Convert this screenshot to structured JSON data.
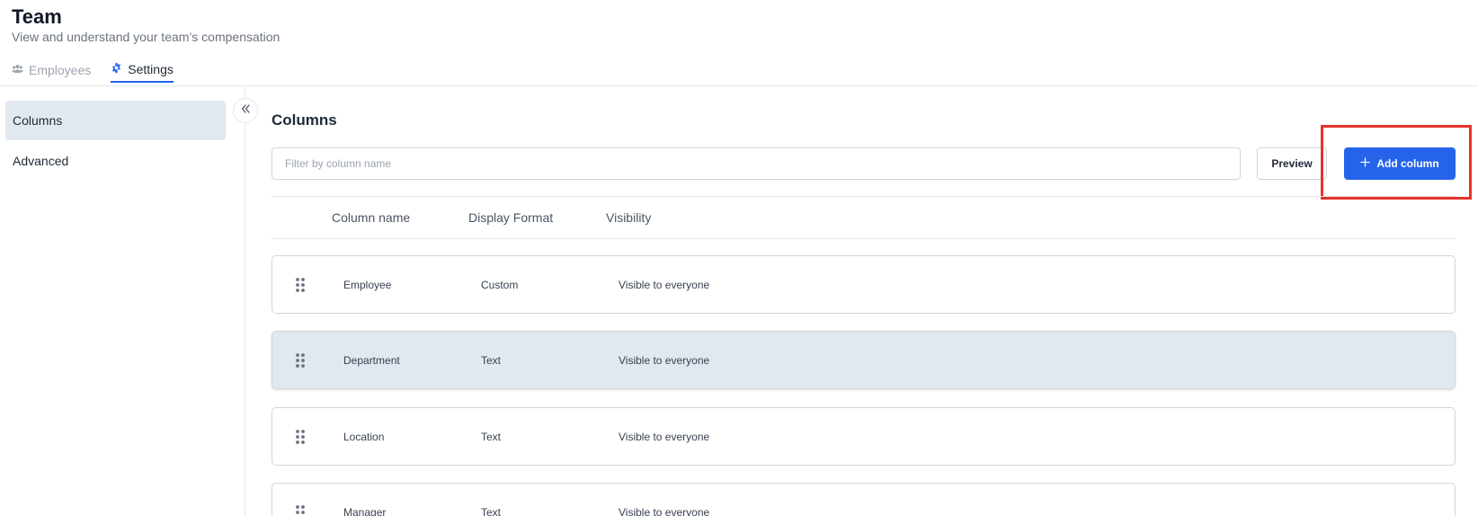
{
  "header": {
    "title": "Team",
    "subtitle": "View and understand your team’s compensation",
    "tabs": [
      {
        "label": "Employees",
        "icon": "users-icon",
        "active": false
      },
      {
        "label": "Settings",
        "icon": "gear-icon",
        "active": true
      }
    ]
  },
  "sidebar": {
    "items": [
      {
        "label": "Columns",
        "active": true
      },
      {
        "label": "Advanced",
        "active": false
      }
    ],
    "collapse_icon": "chevrons-left-icon"
  },
  "main": {
    "title": "Columns",
    "filter": {
      "placeholder": "Filter by column name",
      "value": ""
    },
    "preview_label": "Preview",
    "add_label": "Add column",
    "table": {
      "headers": [
        "Column name",
        "Display Format",
        "Visibility"
      ],
      "rows": [
        {
          "name": "Employee",
          "format": "Custom",
          "visibility": "Visible to everyone"
        },
        {
          "name": "Department",
          "format": "Text",
          "visibility": "Visible to everyone"
        },
        {
          "name": "Location",
          "format": "Text",
          "visibility": "Visible to everyone"
        },
        {
          "name": "Manager",
          "format": "Text",
          "visibility": "Visible to everyone"
        }
      ]
    }
  },
  "colors": {
    "accent": "#2563eb",
    "selected_row": "#e2e8f0",
    "highlight": "#e8332a"
  }
}
